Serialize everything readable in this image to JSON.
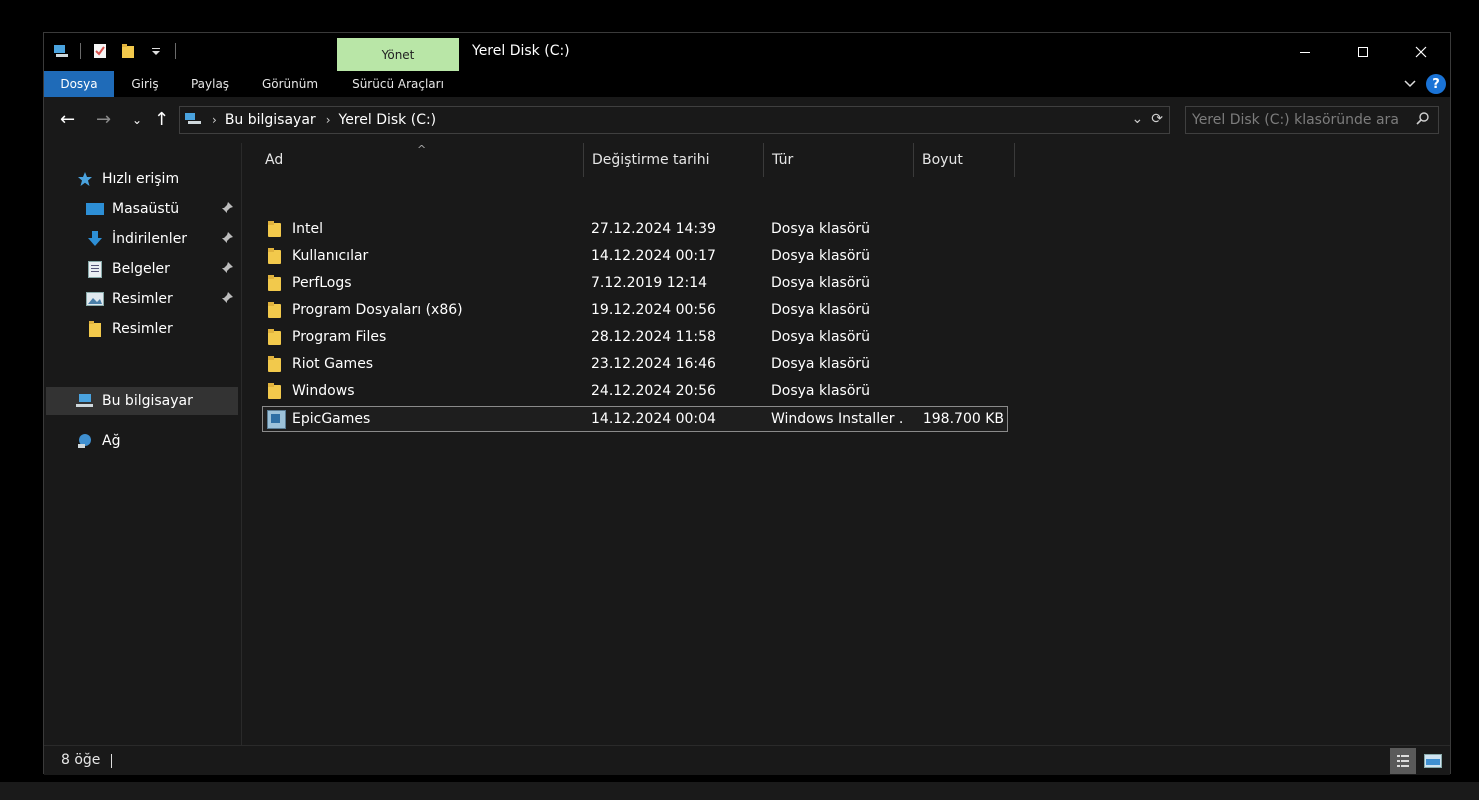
{
  "titlebar": {
    "manage_tab": "Yönet",
    "title": "Yerel Disk (C:)",
    "qat_icons": [
      "computer-icon",
      "properties-icon",
      "new-folder-icon",
      "customize-dropdown-icon"
    ],
    "minimize": "—",
    "maximize": "☐",
    "close": "✕"
  },
  "ribbon": {
    "tabs": [
      {
        "label": "Dosya",
        "active": true
      },
      {
        "label": "Giriş"
      },
      {
        "label": "Paylaş"
      },
      {
        "label": "Görünüm"
      },
      {
        "label": "Sürücü Araçları"
      }
    ],
    "expand_chevron": "⌄",
    "help": "?"
  },
  "nav": {
    "back": "←",
    "forward": "→",
    "recent": "⌄",
    "up": "↑",
    "breadcrumb": [
      "Bu bilgisayar",
      "Yerel Disk (C:)"
    ],
    "sep": "›",
    "dropdown": "⌄",
    "refresh": "⟳",
    "search_placeholder": "Yerel Disk (C:) klasöründe ara",
    "search_icon": "⌕"
  },
  "sidebar": {
    "items": [
      {
        "label": "Hızlı erişim",
        "icon": "star-icon"
      },
      {
        "label": "Masaüstü",
        "icon": "desktop-icon",
        "pinned": true
      },
      {
        "label": "İndirilenler",
        "icon": "download-icon",
        "pinned": true
      },
      {
        "label": "Belgeler",
        "icon": "documents-icon",
        "pinned": true
      },
      {
        "label": "Resimler",
        "icon": "pictures-icon",
        "pinned": true
      },
      {
        "label": "Resimler",
        "icon": "folder-icon"
      },
      {
        "label": "Bu bilgisayar",
        "icon": "computer-icon",
        "selected": true
      },
      {
        "label": "Ağ",
        "icon": "network-icon"
      }
    ],
    "pin_glyph": "📌"
  },
  "columns": [
    {
      "label": "Ad"
    },
    {
      "label": "Değiştirme tarihi"
    },
    {
      "label": "Tür"
    },
    {
      "label": "Boyut"
    }
  ],
  "sort_indicator": "^",
  "files": [
    {
      "name": "Intel",
      "date": "27.12.2024 14:39",
      "type": "Dosya klasörü",
      "size": "",
      "icon": "folder-icon"
    },
    {
      "name": "Kullanıcılar",
      "date": "14.12.2024 00:17",
      "type": "Dosya klasörü",
      "size": "",
      "icon": "folder-icon"
    },
    {
      "name": "PerfLogs",
      "date": "7.12.2019 12:14",
      "type": "Dosya klasörü",
      "size": "",
      "icon": "folder-icon"
    },
    {
      "name": "Program Dosyaları (x86)",
      "date": "19.12.2024 00:56",
      "type": "Dosya klasörü",
      "size": "",
      "icon": "folder-icon"
    },
    {
      "name": "Program Files",
      "date": "28.12.2024 11:58",
      "type": "Dosya klasörü",
      "size": "",
      "icon": "folder-icon"
    },
    {
      "name": "Riot Games",
      "date": "23.12.2024 16:46",
      "type": "Dosya klasörü",
      "size": "",
      "icon": "folder-icon"
    },
    {
      "name": "Windows",
      "date": "24.12.2024 20:56",
      "type": "Dosya klasörü",
      "size": "",
      "icon": "folder-icon"
    },
    {
      "name": "EpicGames",
      "date": "14.12.2024 00:04",
      "type": "Windows Installer ...",
      "size": "198.700 KB",
      "icon": "installer-icon",
      "selected": true
    }
  ],
  "status": {
    "count": "8 öğe",
    "details_view": "☰",
    "large_icons_view": "▭"
  },
  "colors": {
    "window_bg": "#191919",
    "accent": "#1f6bb8",
    "manage_tab": "#b9e6a7",
    "folder": "#f2c94c"
  }
}
